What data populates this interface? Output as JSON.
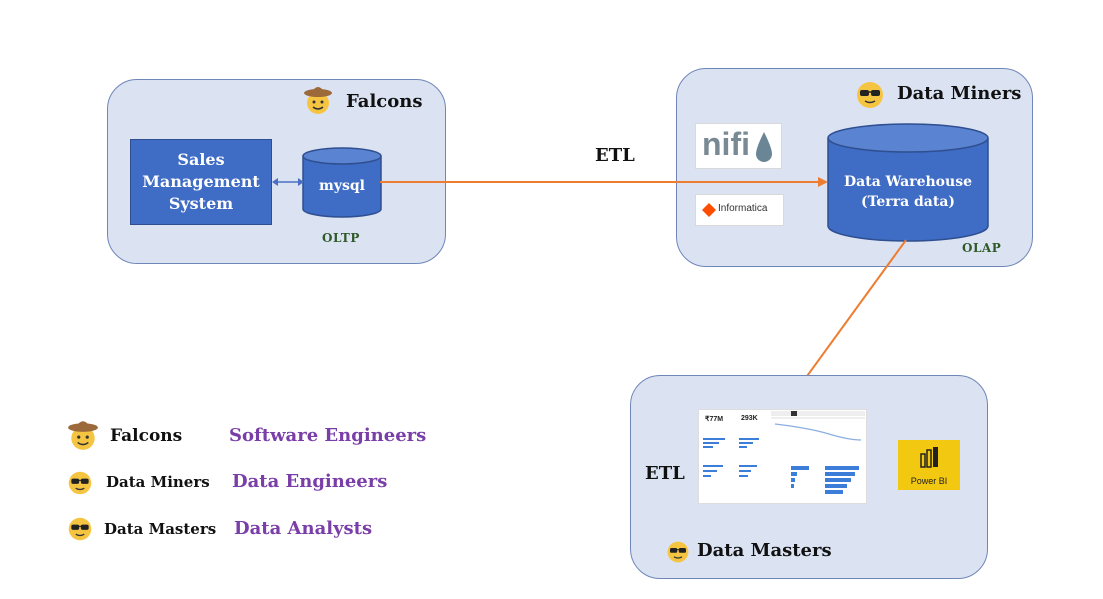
{
  "groups": {
    "falcons": {
      "name": "Falcons"
    },
    "data_miners": {
      "name": "Data Miners"
    },
    "data_masters": {
      "name": "Data Masters"
    }
  },
  "oltp": {
    "system_label": "Sales Management System",
    "db_label": "mysql",
    "tag": "OLTP"
  },
  "olap": {
    "warehouse_label": "Data Warehouse\n(Terra data)",
    "tag": "OLAP",
    "tools": [
      "nifi",
      "Informatica"
    ]
  },
  "etl_labels": {
    "top": "ETL",
    "bottom": "ETL"
  },
  "dashboard": {
    "kpi1": "₹77M",
    "kpi2": "293K"
  },
  "powerbi": {
    "label": "Power BI"
  },
  "legend": [
    {
      "team": "Falcons",
      "role": "Software Engineers",
      "icon": "cowboy-face-icon"
    },
    {
      "team": "Data Miners",
      "role": "Data Engineers",
      "icon": "sunglasses-face-icon"
    },
    {
      "team": "Data Masters",
      "role": "Data Analysts",
      "icon": "sunglasses-face-icon"
    }
  ],
  "colors": {
    "group_fill": "#dbe3f3",
    "group_border": "#6f86b8",
    "box_blue": "#3f6cc4",
    "arrow_orange": "#ed7d31",
    "role_purple": "#7a3ea8"
  }
}
